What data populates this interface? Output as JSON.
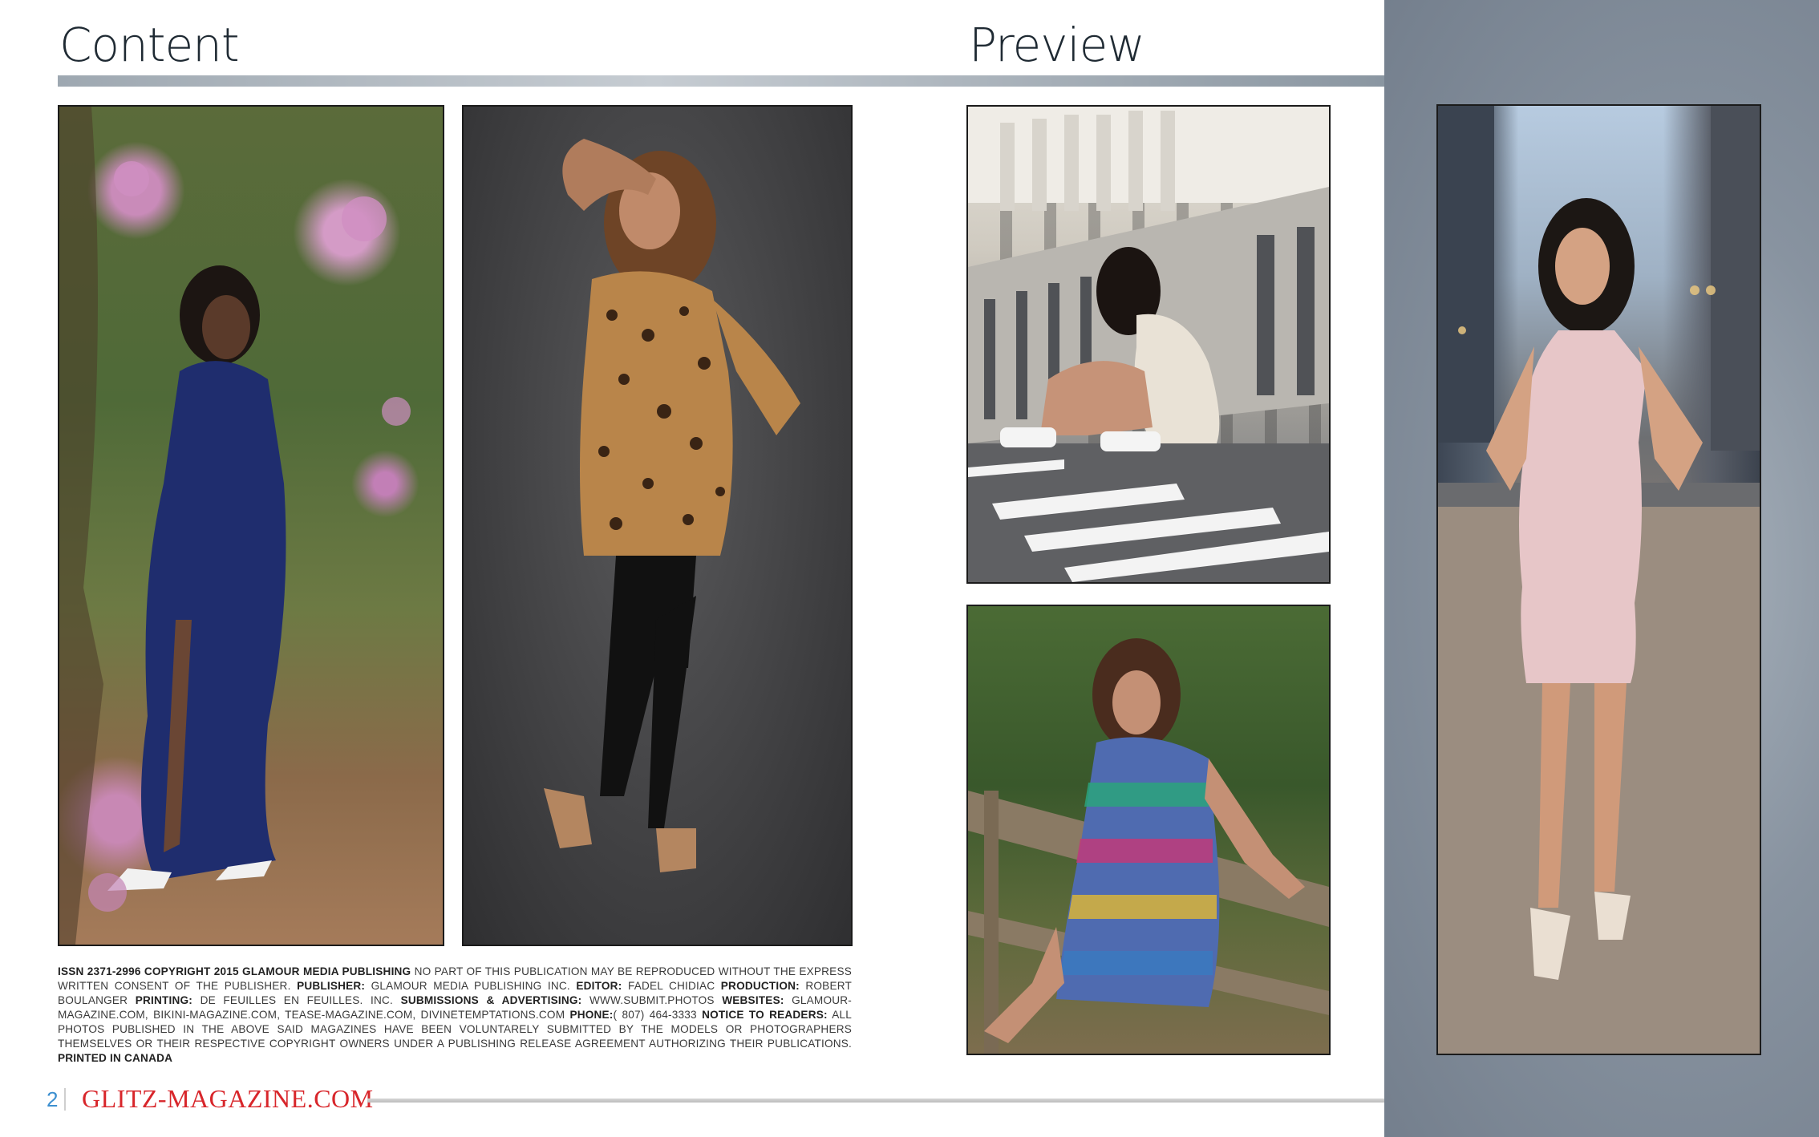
{
  "headings": {
    "content": "Content",
    "preview": "Preview"
  },
  "photos": [
    {
      "name": "photo-blue-gown",
      "description_icon": "woman-photo-icon"
    },
    {
      "name": "photo-leopard-top",
      "description_icon": "woman-photo-icon"
    },
    {
      "name": "photo-bridge-sneakers",
      "description_icon": "woman-photo-icon"
    },
    {
      "name": "photo-sequin-dress",
      "description_icon": "woman-photo-icon"
    },
    {
      "name": "photo-pink-dress-city",
      "description_icon": "woman-photo-icon"
    }
  ],
  "legal": {
    "issn": "ISSN 2371-2996 COPYRIGHT 2015 GLAMOUR MEDIA PUBLISHING",
    "notice": "NO PART OF THIS PUBLICATION MAY BE REPRODUCED WITHOUT THE EXPRESS WRITTEN CONSENT OF THE PUBLISHER.",
    "publisher_label": "PUBLISHER:",
    "publisher": "GLAMOUR MEDIA PUBLISHING INC.",
    "editor_label": "EDITOR:",
    "editor": "FADEL CHIDIAC",
    "production_label": "PRODUCTION:",
    "production": "ROBERT BOULANGER",
    "printing_label": "PRINTING:",
    "printing": "DE FEUILLES EN FEUILLES. INC.",
    "submissions_label": "SUBMISSIONS & ADVERTISING:",
    "submissions": "WWW.SUBMIT.PHOTOS",
    "websites_label": "WEBSITES:",
    "websites": "GLAMOUR-MAGAZINE.COM, BIKINI-MAGAZINE.COM, TEASE-MAGAZINE.COM, DIVINETEMPTATIONS.COM",
    "phone_label": "PHONE:",
    "phone": "( 807) 464-3333",
    "readers_label": "NOTICE TO READERS:",
    "readers": "ALL PHOTOS PUBLISHED IN THE ABOVE SAID MAGAZINES HAVE BEEN VOLUNTARELY SUBMITTED BY THE MODELS OR PHOTOGRAPHERS THEMSELVES OR THEIR RESPECTIVE COPYRIGHT OWNERS UNDER A PUBLISHING RELEASE AGREEMENT AUTHORIZING THEIR PUBLICATIONS.",
    "printed": "PRINTED IN CANADA"
  },
  "footer": {
    "page_number": "2",
    "brand": "GLITZ-MAGAZINE.COM"
  },
  "colors": {
    "brand_red": "#d8262b",
    "page_number_blue": "#3c8fd0",
    "side_panel": "#8893a0"
  }
}
